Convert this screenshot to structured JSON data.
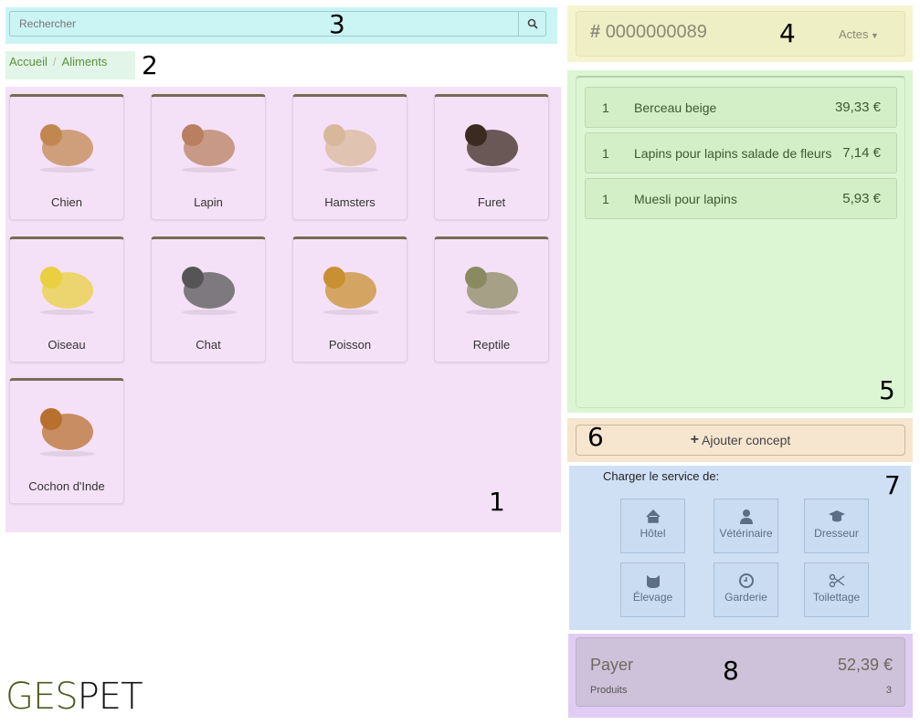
{
  "search": {
    "placeholder": "Rechercher",
    "icon": "search-icon"
  },
  "breadcrumb": [
    {
      "label": "Accueil"
    },
    {
      "label": "Aliments"
    }
  ],
  "categories": [
    {
      "label": "Chien",
      "color": "#c08850"
    },
    {
      "label": "Lapin",
      "color": "#b88060"
    },
    {
      "label": "Hamsters",
      "color": "#d8b89a"
    },
    {
      "label": "Furet",
      "color": "#3a2a20"
    },
    {
      "label": "Oiseau",
      "color": "#e8d040"
    },
    {
      "label": "Chat",
      "color": "#555555"
    },
    {
      "label": "Poisson",
      "color": "#c89030"
    },
    {
      "label": "Reptile",
      "color": "#8a8a60"
    },
    {
      "label": "Cochon d'Inde",
      "color": "#b87030"
    }
  ],
  "ticket": {
    "number": "0000000089",
    "actions_label": "Actes"
  },
  "order_items": [
    {
      "qty": "1",
      "name": "Berceau beige",
      "price": "39,33 €"
    },
    {
      "qty": "1",
      "name": "Lapins pour lapins salade de fleurs",
      "price": "7,14 €"
    },
    {
      "qty": "1",
      "name": "Muesli pour lapins",
      "price": "5,93 €"
    }
  ],
  "add_concept_label": "Ajouter concept",
  "services": {
    "title": "Charger le service de:",
    "items": [
      {
        "label": "Hôtel",
        "icon": "home-icon"
      },
      {
        "label": "Vétérinaire",
        "icon": "doctor-icon"
      },
      {
        "label": "Dresseur",
        "icon": "graduation-cap-icon"
      },
      {
        "label": "Élevage",
        "icon": "github-cat-icon"
      },
      {
        "label": "Garderie",
        "icon": "clock-icon"
      },
      {
        "label": "Toilettage",
        "icon": "scissors-icon"
      }
    ]
  },
  "payment": {
    "label": "Payer",
    "total": "52,39 €",
    "products_label": "Produits",
    "products_count": "3"
  },
  "logo": {
    "part1": "GES",
    "part2": "PET",
    "color1": "#4a5a1e",
    "color2": "#111111"
  },
  "annotations": [
    "1",
    "2",
    "3",
    "4",
    "5",
    "6",
    "7",
    "8"
  ]
}
